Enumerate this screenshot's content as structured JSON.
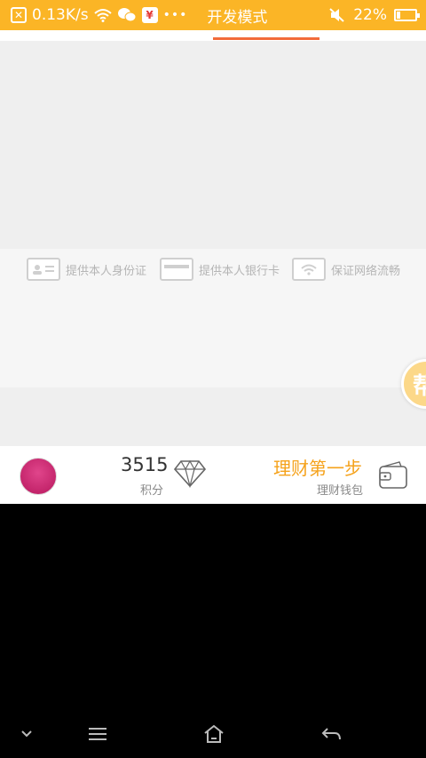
{
  "status_bar": {
    "net_speed": "0.13K/s",
    "mode_label": "开发模式",
    "battery_percent": "22%",
    "battery_level": 0.22,
    "icons": [
      "close-box-icon",
      "wifi-icon",
      "wechat-icon",
      "yuan-icon",
      "more-dots-icon",
      "mute-icon",
      "battery-icon"
    ]
  },
  "features": [
    {
      "icon": "id-card-icon",
      "label": "提供本人身份证"
    },
    {
      "icon": "bank-card-icon",
      "label": "提供本人银行卡"
    },
    {
      "icon": "wifi-card-icon",
      "label": "保证网络流畅"
    }
  ],
  "float_button": {
    "label": "帮"
  },
  "info_bar": {
    "points_value": "3515",
    "points_label": "积分",
    "wallet_title": "理财第一步",
    "wallet_subtitle": "理财钱包"
  },
  "colors": {
    "status_bar": "#FBB526",
    "accent_orange": "#F5A21B",
    "tab_indicator": "#F26B3A"
  },
  "nav_bar": {
    "icons": [
      "chevron-down-icon",
      "menu-icon",
      "home-icon",
      "back-icon"
    ]
  }
}
